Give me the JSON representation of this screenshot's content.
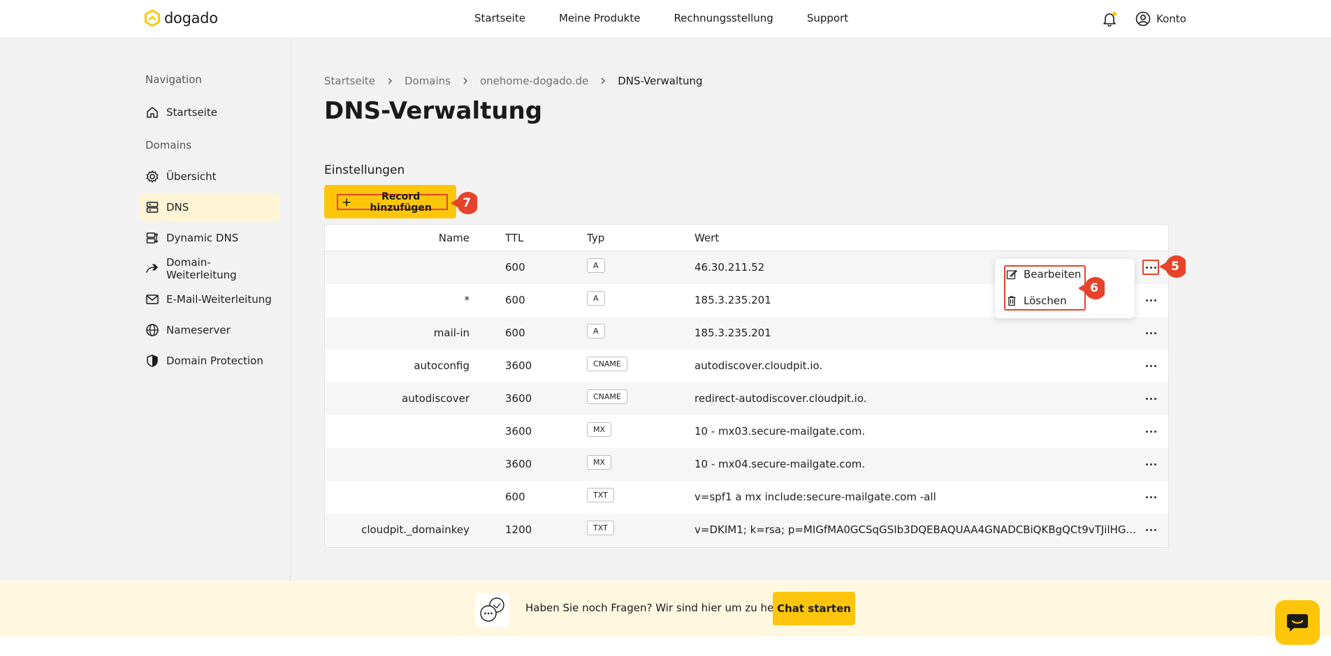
{
  "brand": {
    "name": "dogado"
  },
  "topnav": [
    "Startseite",
    "Meine Produkte",
    "Rechnungsstellung",
    "Support"
  ],
  "account": {
    "label": "Konto"
  },
  "sidebar": {
    "navigation_heading": "Navigation",
    "home_label": "Startseite",
    "domains_heading": "Domains",
    "items": [
      {
        "label": "Übersicht",
        "icon": "gear-icon"
      },
      {
        "label": "DNS",
        "icon": "server-icon"
      },
      {
        "label": "Dynamic DNS",
        "icon": "dynamic-dns-icon"
      },
      {
        "label": "Domain-Weiterleitung",
        "icon": "forward-icon"
      },
      {
        "label": "E-Mail-Weiterleitung",
        "icon": "mail-icon"
      },
      {
        "label": "Nameserver",
        "icon": "globe-icon"
      },
      {
        "label": "Domain Protection",
        "icon": "shield-icon"
      }
    ]
  },
  "breadcrumb": [
    "Startseite",
    "Domains",
    "onehome-dogado.de",
    "DNS-Verwaltung"
  ],
  "page_title": "DNS-Verwaltung",
  "section_title": "Einstellungen",
  "add_button": "Record hinzufügen",
  "annotations": {
    "add": "7",
    "menu": "6",
    "dots": "5"
  },
  "table": {
    "headers": {
      "name": "Name",
      "ttl": "TTL",
      "typ": "Typ",
      "wert": "Wert"
    },
    "rows": [
      {
        "name": "",
        "ttl": "600",
        "typ": "A",
        "wert": "46.30.211.52"
      },
      {
        "name": "*",
        "ttl": "600",
        "typ": "A",
        "wert": "185.3.235.201"
      },
      {
        "name": "mail-in",
        "ttl": "600",
        "typ": "A",
        "wert": "185.3.235.201"
      },
      {
        "name": "autoconfig",
        "ttl": "3600",
        "typ": "CNAME",
        "wert": "autodiscover.cloudpit.io."
      },
      {
        "name": "autodiscover",
        "ttl": "3600",
        "typ": "CNAME",
        "wert": "redirect-autodiscover.cloudpit.io."
      },
      {
        "name": "",
        "ttl": "3600",
        "typ": "MX",
        "wert": "10 - mx03.secure-mailgate.com."
      },
      {
        "name": "",
        "ttl": "3600",
        "typ": "MX",
        "wert": "10 - mx04.secure-mailgate.com."
      },
      {
        "name": "",
        "ttl": "600",
        "typ": "TXT",
        "wert": "v=spf1 a mx include:secure-mailgate.com -all"
      },
      {
        "name": "cloudpit._domainkey",
        "ttl": "1200",
        "typ": "TXT",
        "wert": "v=DKIM1; k=rsa; p=MIGfMA0GCSqGSIb3DQEBAQUAA4GNADCBiQKBgQCt9vTJilHG..."
      }
    ]
  },
  "menu": {
    "edit": "Bearbeiten",
    "delete": "Löschen"
  },
  "help": {
    "text": "Haben Sie noch Fragen? Wir sind hier um zu helfen.",
    "button": "Chat starten"
  },
  "colors": {
    "accent": "#fdc60a",
    "annotation": "#e7422b",
    "active_bg": "#fff5d6"
  }
}
